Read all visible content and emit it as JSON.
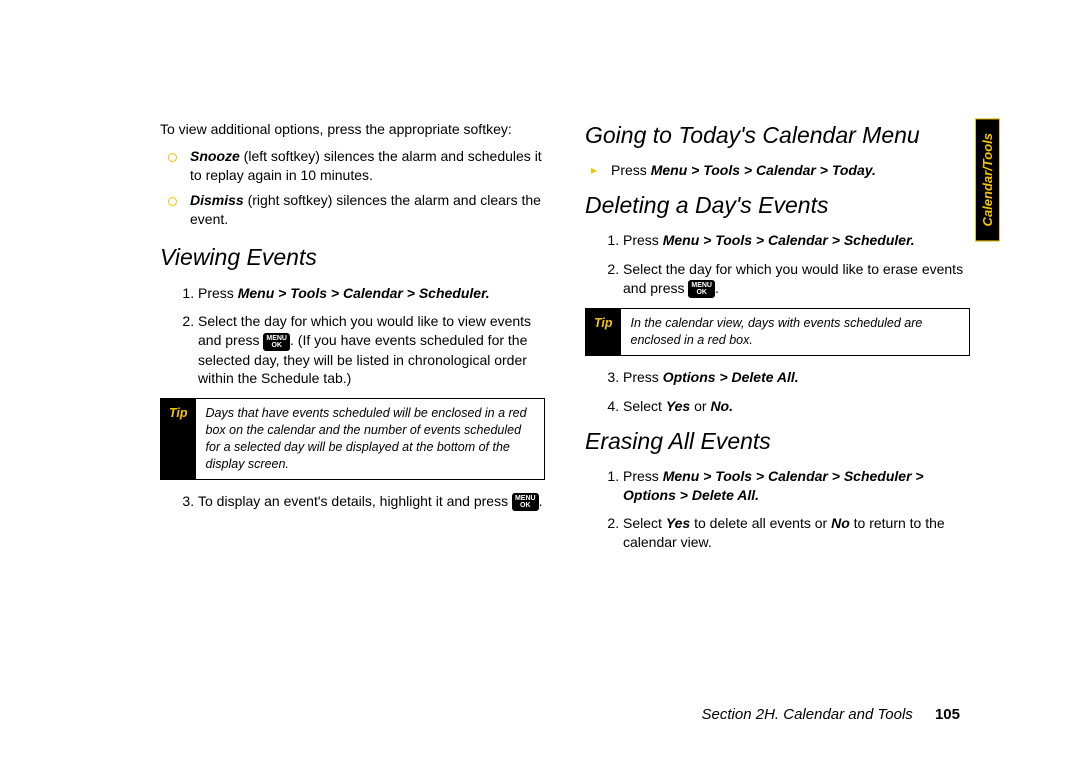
{
  "sideTab": "Calendar/Tools",
  "footer": {
    "section": "Section 2H. Calendar and Tools",
    "page": "105"
  },
  "left": {
    "intro": "To view additional options, press the appropriate softkey:",
    "bullets": [
      {
        "bold": "Snooze",
        "rest": " (left softkey) silences the alarm and schedules it to replay again in 10 minutes."
      },
      {
        "bold": "Dismiss",
        "rest": " (right softkey) silences the alarm and clears the event."
      }
    ],
    "h_viewing": "Viewing Events",
    "step1_a": "Press ",
    "step1_b": "Menu > Tools > Calendar > Scheduler.",
    "step2_a": "Select the day for which you would like to view events and press ",
    "step2_b": ". (If you have events scheduled for the selected day, they will be listed in chronological order within the Schedule tab.)",
    "tipLabel": "Tip",
    "tipText": "Days that have events scheduled will be enclosed in a red box on the calendar and the number of events scheduled for a selected day will be displayed at the bottom of the display screen.",
    "step3_a": "To display an event's details, highlight it and press ",
    "step3_b": "."
  },
  "right": {
    "h_today": "Going to Today's Calendar Menu",
    "today_a": "Press ",
    "today_b": "Menu > Tools > Calendar > Today.",
    "h_delete": "Deleting a Day's Events",
    "d1_a": "Press ",
    "d1_b": "Menu > Tools > Calendar > Scheduler.",
    "d2_a": "Select the day for which you would like to erase events and press ",
    "d2_b": ".",
    "tipLabel": "Tip",
    "tipText": "In the calendar view, days with events scheduled are enclosed in a red box.",
    "d3_a": "Press ",
    "d3_b": "Options > Delete All.",
    "d4_a": "Select ",
    "d4_b": "Yes",
    "d4_c": " or ",
    "d4_d": "No.",
    "h_erase": "Erasing All Events",
    "e1_a": "Press ",
    "e1_b": "Menu > Tools > Calendar > Scheduler > Options > Delete All.",
    "e2_a": "Select ",
    "e2_b": "Yes",
    "e2_c": " to delete all events or ",
    "e2_d": "No",
    "e2_e": " to return to the calendar view."
  },
  "menuOk": {
    "line1": "MENU",
    "line2": "OK"
  }
}
